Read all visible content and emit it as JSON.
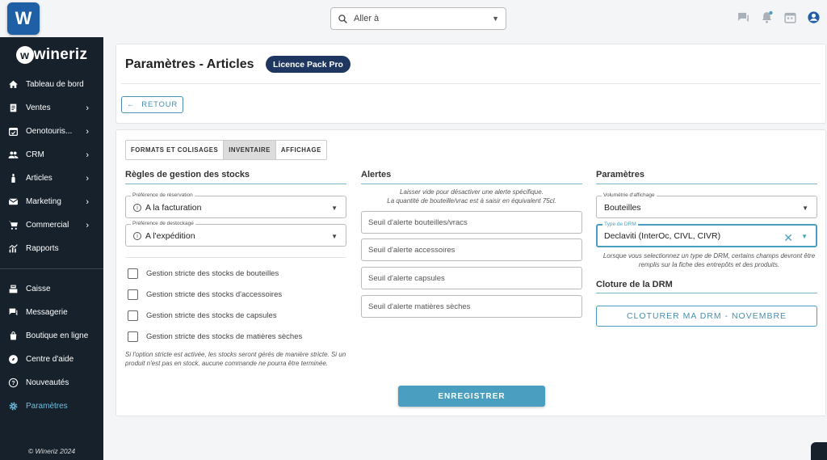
{
  "topbar": {
    "logo_letter": "W",
    "goto_placeholder": "Aller à",
    "icons": [
      "chat-icon",
      "bell-icon",
      "calendar-icon",
      "account-icon"
    ]
  },
  "sidebar": {
    "brand": "wineriz",
    "items": [
      {
        "label": "Tableau de bord",
        "icon": "home-icon",
        "chevron": false
      },
      {
        "label": "Ventes",
        "icon": "receipt-icon",
        "chevron": true
      },
      {
        "label": "Oenotouris...",
        "icon": "calendar-check-icon",
        "chevron": true
      },
      {
        "label": "CRM",
        "icon": "people-icon",
        "chevron": true
      },
      {
        "label": "Articles",
        "icon": "bottle-icon",
        "chevron": true
      },
      {
        "label": "Marketing",
        "icon": "mail-icon",
        "chevron": true
      },
      {
        "label": "Commercial",
        "icon": "cart-icon",
        "chevron": true
      },
      {
        "label": "Rapports",
        "icon": "chart-icon",
        "chevron": false
      }
    ],
    "items2": [
      {
        "label": "Caisse",
        "icon": "register-icon"
      },
      {
        "label": "Messagerie",
        "icon": "chat-icon"
      },
      {
        "label": "Boutique en ligne",
        "icon": "shop-icon"
      },
      {
        "label": "Centre d'aide",
        "icon": "compass-icon"
      },
      {
        "label": "Nouveautés",
        "icon": "help-icon"
      },
      {
        "label": "Paramètres",
        "icon": "gear-icon",
        "active": true
      }
    ],
    "footer": "© Wineriz 2024"
  },
  "header": {
    "title": "Paramètres - Articles",
    "badge": "Licence Pack Pro",
    "back_label": "RETOUR"
  },
  "tabs": [
    {
      "label": "FORMATS ET COLISAGES",
      "selected": false
    },
    {
      "label": "INVENTAIRE",
      "selected": true
    },
    {
      "label": "AFFICHAGE",
      "selected": false
    }
  ],
  "stock_rules": {
    "title": "Règles de gestion des stocks",
    "reservation_label": "Préférence de réservation",
    "reservation_value": "A la facturation",
    "destock_label": "Préférence de destockage",
    "destock_value": "A l'expédition",
    "checks": [
      "Gestion stricte des stocks de bouteilles",
      "Gestion stricte des stocks d'accessoires",
      "Gestion stricte des stocks de capsules",
      "Gestion stricte des stocks de matières sèches"
    ],
    "note": "Si l'option stricte est activée, les stocks seront gérés de manière stricte. Si un produit n'est pas en stock, aucune commande ne pourra être terminée."
  },
  "alerts": {
    "title": "Alertes",
    "note_line1": "Laisser vide pour désactiver une alerte spécifique.",
    "note_line2": "La quantité de bouteille/vrac est à saisir en équivalent 75cl.",
    "fields": [
      "Seuil d'alerte bouteilles/vracs",
      "Seuil d'alerte accessoires",
      "Seuil d'alerte capsules",
      "Seuil d'alerte matières sèches"
    ]
  },
  "params": {
    "title": "Paramètres",
    "volume_label": "Volumétrie d'affichage",
    "volume_value": "Bouteilles",
    "drm_label": "Type de DRM",
    "drm_value": "Declaviti (InterOc, CIVL, CIVR)",
    "drm_note": "Lorsque vous selectionnez un type de DRM, certains champs devront être remplis sur la fiche des entrepôts et des produits.",
    "close_title": "Cloture de la DRM",
    "close_button": "CLOTURER MA DRM - NOVEMBRE"
  },
  "save_label": "ENREGISTRER",
  "colors": {
    "accent": "#4a9fc0",
    "sidebar": "#16212b",
    "badge": "#1e3660"
  }
}
